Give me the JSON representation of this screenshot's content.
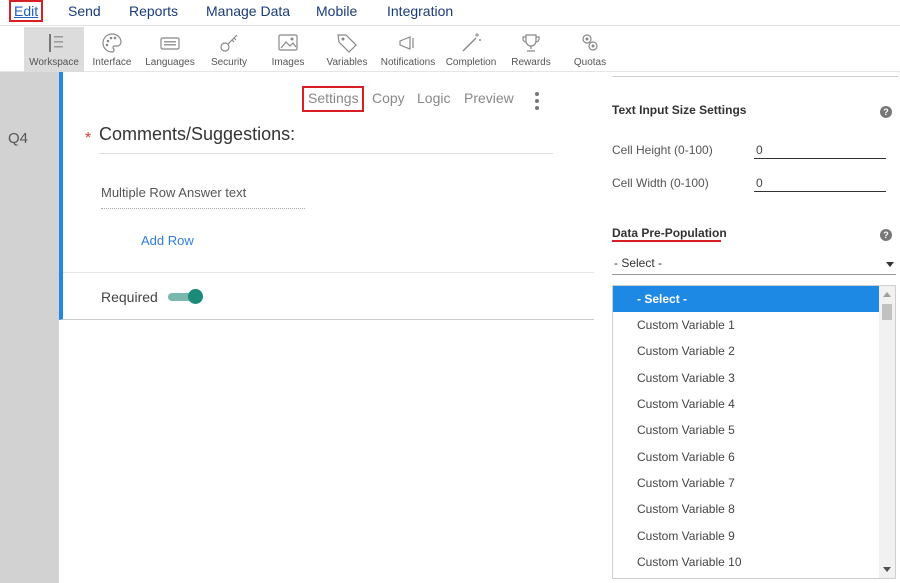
{
  "menu": {
    "items": [
      {
        "label": "Edit",
        "active": true
      },
      {
        "label": "Send"
      },
      {
        "label": "Reports"
      },
      {
        "label": "Manage Data"
      },
      {
        "label": "Mobile"
      },
      {
        "label": "Integration"
      }
    ]
  },
  "toolbar": {
    "tools": [
      {
        "label": "Workspace",
        "icon": "workspace-icon",
        "selected": true
      },
      {
        "label": "Interface",
        "icon": "palette-icon"
      },
      {
        "label": "Languages",
        "icon": "keyboard-icon"
      },
      {
        "label": "Security",
        "icon": "key-icon"
      },
      {
        "label": "Images",
        "icon": "image-icon"
      },
      {
        "label": "Variables",
        "icon": "tag-icon"
      },
      {
        "label": "Notifications",
        "icon": "megaphone-icon"
      },
      {
        "label": "Completion",
        "icon": "magic-wand-icon"
      },
      {
        "label": "Rewards",
        "icon": "trophy-icon"
      },
      {
        "label": "Quotas",
        "icon": "quotas-icon"
      }
    ]
  },
  "question": {
    "number": "Q4",
    "required_mark": "*",
    "title": "Comments/Suggestions:",
    "actions": {
      "settings": "Settings",
      "copy": "Copy",
      "logic": "Logic",
      "preview": "Preview"
    },
    "answer_text": "Multiple Row Answer text",
    "add_row": "Add Row",
    "required_label": "Required",
    "required_on": true
  },
  "panel": {
    "text_input_title": "Text Input Size Settings",
    "help": "?",
    "cell_height_label": "Cell Height (0-100)",
    "cell_height_value": "0",
    "cell_width_label": "Cell Width (0-100)",
    "cell_width_value": "0",
    "dpp_title": "Data Pre-Population",
    "select_value": "- Select -",
    "options": [
      "- Select -",
      "Custom Variable 1",
      "Custom Variable 2",
      "Custom Variable 3",
      "Custom Variable 4",
      "Custom Variable 5",
      "Custom Variable 6",
      "Custom Variable 7",
      "Custom Variable 8",
      "Custom Variable 9",
      "Custom Variable 10"
    ]
  },
  "colors": {
    "accent": "#1e88e5",
    "highlight_box": "#d91f26",
    "toggle_on": "#1a8a79",
    "menu_text": "#1a3b7a"
  }
}
